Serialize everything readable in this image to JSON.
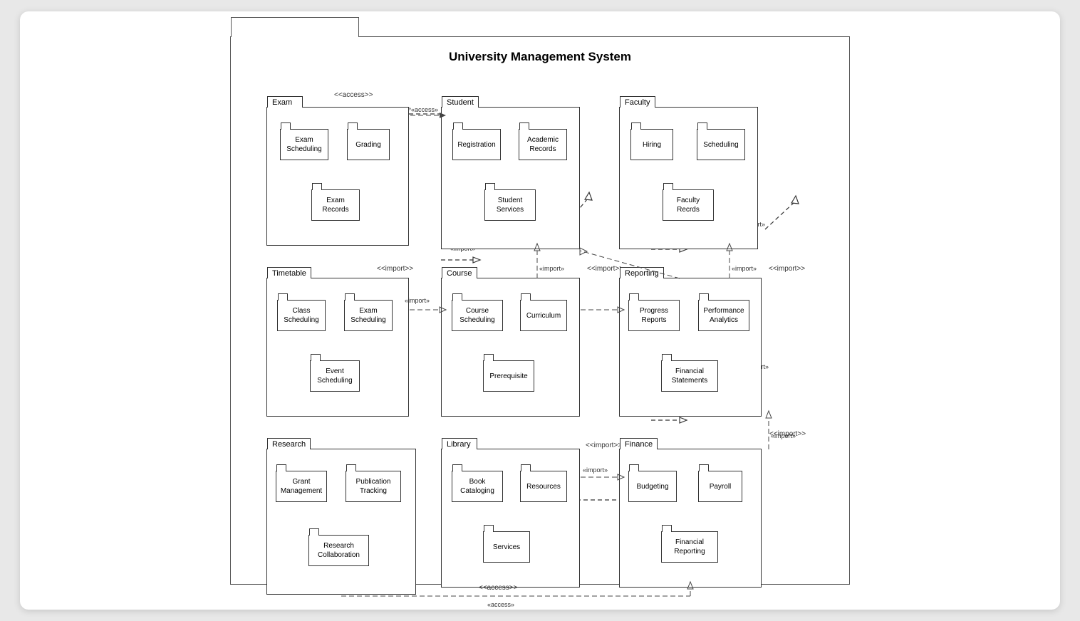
{
  "diagram": {
    "title": "University Management System",
    "packages": {
      "exam": {
        "label": "Exam",
        "subpackages": [
          "Exam Scheduling",
          "Grading",
          "Exam Records"
        ]
      },
      "student": {
        "label": "Student",
        "subpackages": [
          "Registration",
          "Academic Records",
          "Student Services"
        ]
      },
      "faculty": {
        "label": "Faculty",
        "subpackages": [
          "Hiring",
          "Scheduling",
          "Faculty Recrds"
        ]
      },
      "timetable": {
        "label": "Timetable",
        "subpackages": [
          "Class Scheduling",
          "Exam Scheduling",
          "Event Scheduling"
        ]
      },
      "course": {
        "label": "Course",
        "subpackages": [
          "Course Scheduling",
          "Curriculum",
          "Prerequisite"
        ]
      },
      "reporting": {
        "label": "Reporting",
        "subpackages": [
          "Progress Reports",
          "Performance Analytics",
          "Financial Statements"
        ]
      },
      "research": {
        "label": "Research",
        "subpackages": [
          "Grant Management",
          "Publication Tracking",
          "Research Collaboration"
        ]
      },
      "library": {
        "label": "Library",
        "subpackages": [
          "Book Cataloging",
          "Resources",
          "Services"
        ]
      },
      "finance": {
        "label": "Finance",
        "subpackages": [
          "Budgeting",
          "Payroll",
          "Financial Reporting"
        ]
      }
    },
    "stereotypes": {
      "access1": "<<access>>",
      "import1": "<<import>>",
      "import2": "<<import>>",
      "import3": "<<import>>",
      "import4": "<<import>>",
      "import5": "<<import>>",
      "access2": "<<access>>"
    }
  }
}
